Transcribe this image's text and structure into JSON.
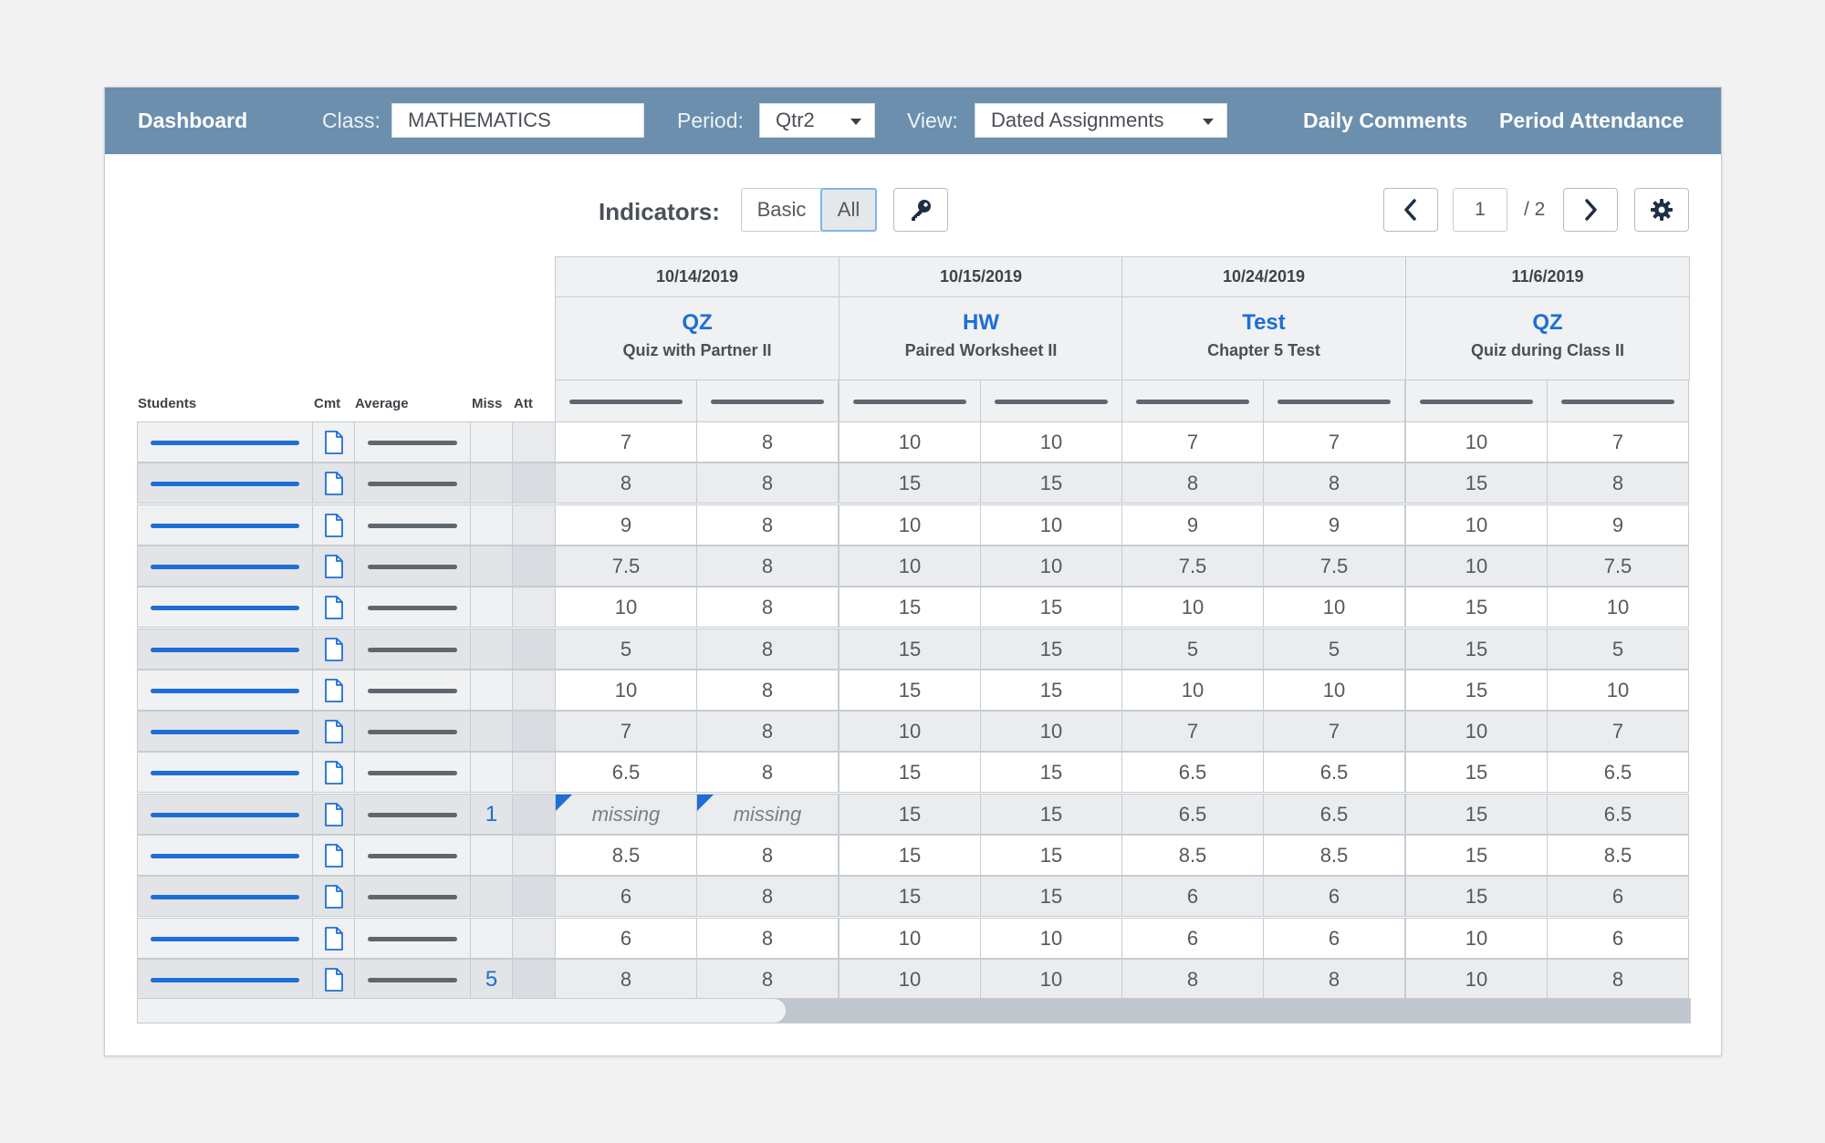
{
  "topbar": {
    "dashboard": "Dashboard",
    "class_label": "Class:",
    "class_value": "MATHEMATICS",
    "period_label": "Period:",
    "period_value": "Qtr2",
    "view_label": "View:",
    "view_value": "Dated Assignments",
    "daily_comments": "Daily Comments",
    "period_attendance": "Period Attendance"
  },
  "toolbar": {
    "indicators_label": "Indicators:",
    "basic": "Basic",
    "all": "All",
    "page_current": "1",
    "page_total": "/ 2"
  },
  "columns": {
    "students": "Students",
    "cmt": "Cmt",
    "average": "Average",
    "miss": "Miss",
    "att": "Att"
  },
  "assignments": [
    {
      "date": "10/14/2019",
      "type": "QZ",
      "name": "Quiz with Partner II"
    },
    {
      "date": "10/15/2019",
      "type": "HW",
      "name": "Paired Worksheet II"
    },
    {
      "date": "10/24/2019",
      "type": "Test",
      "name": "Chapter 5 Test"
    },
    {
      "date": "11/6/2019",
      "type": "QZ",
      "name": "Quiz during Class II"
    }
  ],
  "rows": [
    {
      "miss": "",
      "scores": [
        "7",
        "8",
        "10",
        "10",
        "7",
        "7",
        "10",
        "7"
      ]
    },
    {
      "miss": "",
      "scores": [
        "8",
        "8",
        "15",
        "15",
        "8",
        "8",
        "15",
        "8"
      ]
    },
    {
      "miss": "",
      "scores": [
        "9",
        "8",
        "10",
        "10",
        "9",
        "9",
        "10",
        "9"
      ]
    },
    {
      "miss": "",
      "scores": [
        "7.5",
        "8",
        "10",
        "10",
        "7.5",
        "7.5",
        "10",
        "7.5"
      ]
    },
    {
      "miss": "",
      "scores": [
        "10",
        "8",
        "15",
        "15",
        "10",
        "10",
        "15",
        "10"
      ]
    },
    {
      "miss": "",
      "scores": [
        "5",
        "8",
        "15",
        "15",
        "5",
        "5",
        "15",
        "5"
      ]
    },
    {
      "miss": "",
      "scores": [
        "10",
        "8",
        "15",
        "15",
        "10",
        "10",
        "15",
        "10"
      ]
    },
    {
      "miss": "",
      "scores": [
        "7",
        "8",
        "10",
        "10",
        "7",
        "7",
        "10",
        "7"
      ]
    },
    {
      "miss": "",
      "scores": [
        "6.5",
        "8",
        "15",
        "15",
        "6.5",
        "6.5",
        "15",
        "6.5"
      ]
    },
    {
      "miss": "1",
      "scores": [
        "missing",
        "missing",
        "15",
        "15",
        "6.5",
        "6.5",
        "15",
        "6.5"
      ]
    },
    {
      "miss": "",
      "scores": [
        "8.5",
        "8",
        "15",
        "15",
        "8.5",
        "8.5",
        "15",
        "8.5"
      ]
    },
    {
      "miss": "",
      "scores": [
        "6",
        "8",
        "15",
        "15",
        "6",
        "6",
        "15",
        "6"
      ]
    },
    {
      "miss": "",
      "scores": [
        "6",
        "8",
        "10",
        "10",
        "6",
        "6",
        "10",
        "6"
      ]
    },
    {
      "miss": "5",
      "scores": [
        "8",
        "8",
        "10",
        "10",
        "8",
        "8",
        "10",
        "8"
      ]
    }
  ],
  "colors": {
    "topbar": "#6b8fad",
    "accent": "#1c6fd6",
    "row_alt": "#ebecee"
  },
  "icons": {
    "comment": "document-icon",
    "key": "key-icon",
    "prev": "chevron-left-icon",
    "next": "chevron-right-icon",
    "settings": "gear-icon"
  }
}
